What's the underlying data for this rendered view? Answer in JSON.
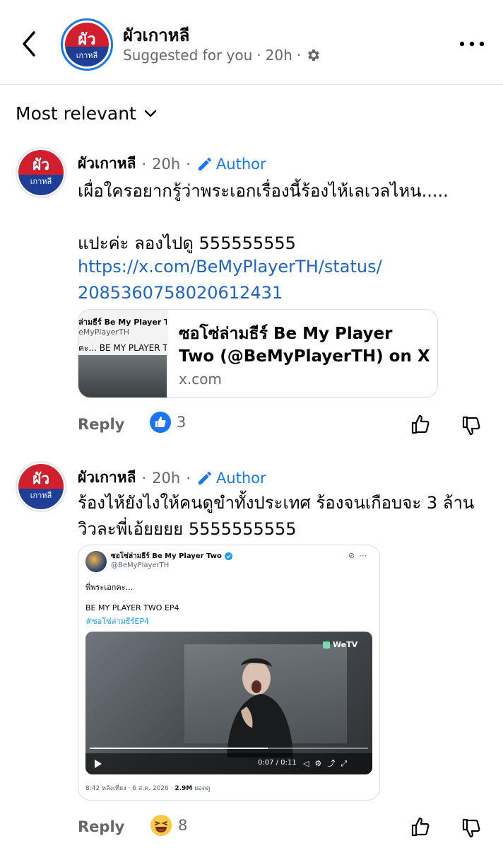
{
  "header": {
    "title": "ผัวเกาหลี",
    "subtitle": "Suggested for you",
    "dot": "·",
    "time": "20h",
    "avatar_line1": "ผัว",
    "avatar_line2": "เกาหลี"
  },
  "sort": {
    "label": "Most relevant"
  },
  "comments": [
    {
      "name": "ผัวเกาหลี",
      "dot": "·",
      "time": "20h",
      "badge": "Author",
      "text": "เผื่อใครอยากรู้ว่าพระเอกเรื่องนี้ร้องไห้เลเวลไหน.....\n\nแปะค่ะ ลองไปดู 555555555",
      "link_line1": "https://x.com/BeMyPlayerTH/status/",
      "link_line2": "2085360758020612431",
      "link_card": {
        "title": "ซอโซ่ล่ามธีร์ Be My Player Two (@BeMyPlayerTH) on X",
        "domain": "x.com",
        "thumb_name": "ล่ามธีร์ Be My Player Two",
        "thumb_handle": "eMyPlayerTH",
        "thumb_text": "คะ... BE MY PLAYER TW"
      },
      "reply": "Reply",
      "reaction": "like",
      "reaction_count": "3"
    },
    {
      "name": "ผัวเกาหลี",
      "dot": "·",
      "time": "20h",
      "badge": "Author",
      "text": "ร้องไห้ยังไงให้คนดูขำทั้งประเทศ ร้องจนเกือบจะ 3 ล้านวิวละพี่เอ้ยยยย 5555555555",
      "embed": {
        "name": "ซอโซ่ล่ามธีร์ Be My Player Two",
        "handle": "@BeMyPlayerTH",
        "line1": "พี่พระเอกคะ...",
        "line2": "BE MY PLAYER TWO EP4",
        "hashtag": "#ซอโซ่ล่ามธีร์EP4",
        "video_brand": "WeTV",
        "video_time": "0:07 / 0:11",
        "progress": 0.64,
        "footer_date": "8:42 หลังเที่ยง · 6 ส.ค. 2026 ·",
        "footer_views": "2.9M",
        "footer_views_label": "ยอดดู"
      },
      "reply": "Reply",
      "reaction": "haha",
      "reaction_count": "8"
    }
  ],
  "colors": {
    "accent": "#1877f2",
    "link": "#1e64c8",
    "secondary_text": "#65676b",
    "logo_red": "#d11f2e",
    "logo_blue": "#1f3f96"
  }
}
